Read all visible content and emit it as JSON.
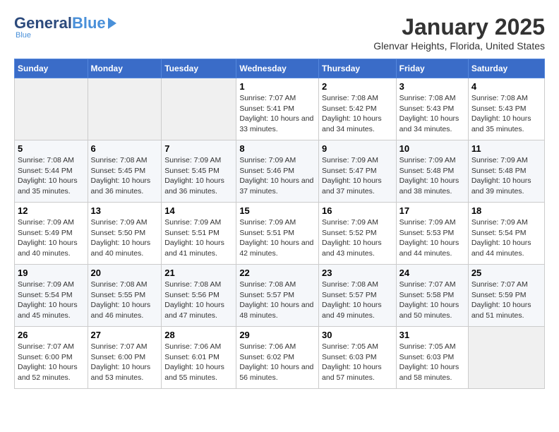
{
  "header": {
    "logo_general": "General",
    "logo_blue": "Blue",
    "month_title": "January 2025",
    "location": "Glenvar Heights, Florida, United States"
  },
  "days_of_week": [
    "Sunday",
    "Monday",
    "Tuesday",
    "Wednesday",
    "Thursday",
    "Friday",
    "Saturday"
  ],
  "weeks": [
    [
      {
        "day": "",
        "sunrise": "",
        "sunset": "",
        "daylight": ""
      },
      {
        "day": "",
        "sunrise": "",
        "sunset": "",
        "daylight": ""
      },
      {
        "day": "",
        "sunrise": "",
        "sunset": "",
        "daylight": ""
      },
      {
        "day": "1",
        "sunrise": "7:07 AM",
        "sunset": "5:41 PM",
        "daylight": "10 hours and 33 minutes."
      },
      {
        "day": "2",
        "sunrise": "7:08 AM",
        "sunset": "5:42 PM",
        "daylight": "10 hours and 34 minutes."
      },
      {
        "day": "3",
        "sunrise": "7:08 AM",
        "sunset": "5:43 PM",
        "daylight": "10 hours and 34 minutes."
      },
      {
        "day": "4",
        "sunrise": "7:08 AM",
        "sunset": "5:43 PM",
        "daylight": "10 hours and 35 minutes."
      }
    ],
    [
      {
        "day": "5",
        "sunrise": "7:08 AM",
        "sunset": "5:44 PM",
        "daylight": "10 hours and 35 minutes."
      },
      {
        "day": "6",
        "sunrise": "7:08 AM",
        "sunset": "5:45 PM",
        "daylight": "10 hours and 36 minutes."
      },
      {
        "day": "7",
        "sunrise": "7:09 AM",
        "sunset": "5:45 PM",
        "daylight": "10 hours and 36 minutes."
      },
      {
        "day": "8",
        "sunrise": "7:09 AM",
        "sunset": "5:46 PM",
        "daylight": "10 hours and 37 minutes."
      },
      {
        "day": "9",
        "sunrise": "7:09 AM",
        "sunset": "5:47 PM",
        "daylight": "10 hours and 37 minutes."
      },
      {
        "day": "10",
        "sunrise": "7:09 AM",
        "sunset": "5:48 PM",
        "daylight": "10 hours and 38 minutes."
      },
      {
        "day": "11",
        "sunrise": "7:09 AM",
        "sunset": "5:48 PM",
        "daylight": "10 hours and 39 minutes."
      }
    ],
    [
      {
        "day": "12",
        "sunrise": "7:09 AM",
        "sunset": "5:49 PM",
        "daylight": "10 hours and 40 minutes."
      },
      {
        "day": "13",
        "sunrise": "7:09 AM",
        "sunset": "5:50 PM",
        "daylight": "10 hours and 40 minutes."
      },
      {
        "day": "14",
        "sunrise": "7:09 AM",
        "sunset": "5:51 PM",
        "daylight": "10 hours and 41 minutes."
      },
      {
        "day": "15",
        "sunrise": "7:09 AM",
        "sunset": "5:51 PM",
        "daylight": "10 hours and 42 minutes."
      },
      {
        "day": "16",
        "sunrise": "7:09 AM",
        "sunset": "5:52 PM",
        "daylight": "10 hours and 43 minutes."
      },
      {
        "day": "17",
        "sunrise": "7:09 AM",
        "sunset": "5:53 PM",
        "daylight": "10 hours and 44 minutes."
      },
      {
        "day": "18",
        "sunrise": "7:09 AM",
        "sunset": "5:54 PM",
        "daylight": "10 hours and 44 minutes."
      }
    ],
    [
      {
        "day": "19",
        "sunrise": "7:09 AM",
        "sunset": "5:54 PM",
        "daylight": "10 hours and 45 minutes."
      },
      {
        "day": "20",
        "sunrise": "7:08 AM",
        "sunset": "5:55 PM",
        "daylight": "10 hours and 46 minutes."
      },
      {
        "day": "21",
        "sunrise": "7:08 AM",
        "sunset": "5:56 PM",
        "daylight": "10 hours and 47 minutes."
      },
      {
        "day": "22",
        "sunrise": "7:08 AM",
        "sunset": "5:57 PM",
        "daylight": "10 hours and 48 minutes."
      },
      {
        "day": "23",
        "sunrise": "7:08 AM",
        "sunset": "5:57 PM",
        "daylight": "10 hours and 49 minutes."
      },
      {
        "day": "24",
        "sunrise": "7:07 AM",
        "sunset": "5:58 PM",
        "daylight": "10 hours and 50 minutes."
      },
      {
        "day": "25",
        "sunrise": "7:07 AM",
        "sunset": "5:59 PM",
        "daylight": "10 hours and 51 minutes."
      }
    ],
    [
      {
        "day": "26",
        "sunrise": "7:07 AM",
        "sunset": "6:00 PM",
        "daylight": "10 hours and 52 minutes."
      },
      {
        "day": "27",
        "sunrise": "7:07 AM",
        "sunset": "6:00 PM",
        "daylight": "10 hours and 53 minutes."
      },
      {
        "day": "28",
        "sunrise": "7:06 AM",
        "sunset": "6:01 PM",
        "daylight": "10 hours and 55 minutes."
      },
      {
        "day": "29",
        "sunrise": "7:06 AM",
        "sunset": "6:02 PM",
        "daylight": "10 hours and 56 minutes."
      },
      {
        "day": "30",
        "sunrise": "7:05 AM",
        "sunset": "6:03 PM",
        "daylight": "10 hours and 57 minutes."
      },
      {
        "day": "31",
        "sunrise": "7:05 AM",
        "sunset": "6:03 PM",
        "daylight": "10 hours and 58 minutes."
      },
      {
        "day": "",
        "sunrise": "",
        "sunset": "",
        "daylight": ""
      }
    ]
  ]
}
